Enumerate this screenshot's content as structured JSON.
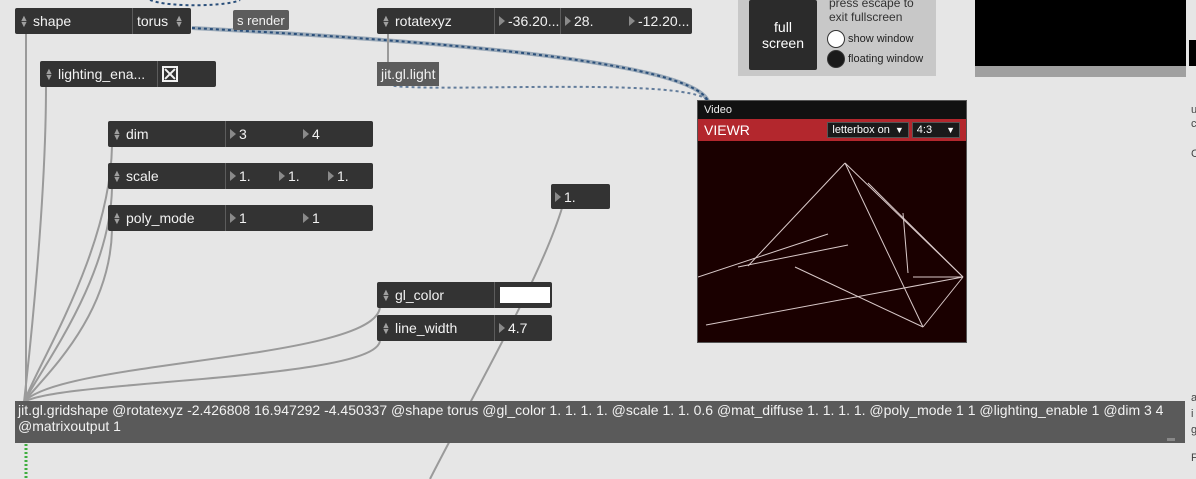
{
  "objects": {
    "shape": {
      "name": "shape",
      "value": "torus"
    },
    "send_render": {
      "text": "s render"
    },
    "rotatexyz": {
      "name": "rotatexyz",
      "values": [
        "-36.20...",
        "28.",
        "-12.20..."
      ]
    },
    "lighting": {
      "name": "lighting_ena..."
    },
    "jit_gl_light": {
      "text": "jit.gl.light"
    },
    "dim": {
      "name": "dim",
      "values": [
        "3",
        "4"
      ]
    },
    "scale": {
      "name": "scale",
      "values": [
        "1.",
        "1.",
        "1."
      ]
    },
    "poly_mode": {
      "name": "poly_mode",
      "values": [
        "1",
        "1"
      ]
    },
    "float_box": {
      "value": "1."
    },
    "gl_color": {
      "name": "gl_color",
      "swatch": "#ffffff"
    },
    "line_width": {
      "name": "line_width",
      "value": "4.7"
    },
    "gridshape": {
      "text": "jit.gl.gridshape @rotatexyz -2.426808 16.947292 -4.450337 @shape torus @gl_color 1. 1. 1. 1. @scale 1. 1. 0.6 @mat_diffuse 1. 1. 1. 1. @poly_mode 1 1 @lighting_enable 1 @dim 3 4 @matrixoutput 1"
    }
  },
  "video": {
    "title": "Video",
    "label": "VIEWR",
    "letterbox": "letterbox on",
    "aspect": "4:3"
  },
  "fullscreen": {
    "button_line1": "full",
    "button_line2": "screen",
    "note_line1": "press escape to",
    "note_line2": "exit fullscreen",
    "show_window": "show window",
    "floating_window": "floating window"
  },
  "edge": [
    "u",
    "c",
    "C",
    "a",
    "i",
    "g",
    "F"
  ],
  "colors": {
    "accent": "#b3272d",
    "object_bg": "#333333",
    "patch_bg": "#e6e6e6"
  }
}
